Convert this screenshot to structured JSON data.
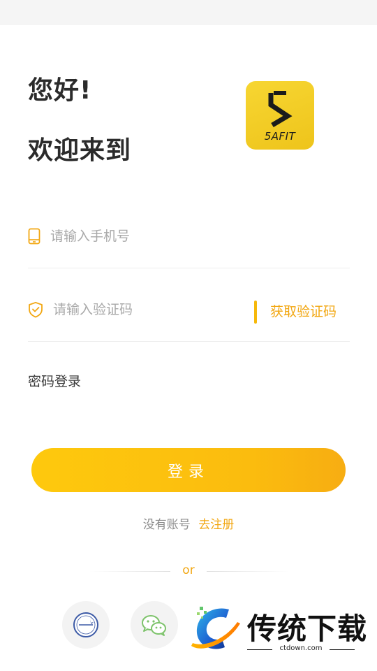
{
  "greeting": {
    "line1": "您好!",
    "line2": "欢迎来到"
  },
  "logo": {
    "text": "5AFIT",
    "bg_color": "#f2cb20"
  },
  "form": {
    "phone_placeholder": "请输入手机号",
    "code_placeholder": "请输入验证码",
    "get_code_label": "获取验证码",
    "password_login_label": "密码登录",
    "login_button": "登录"
  },
  "register": {
    "prompt": "没有账号",
    "link": "去注册"
  },
  "divider": {
    "text": "or"
  },
  "social": [
    {
      "name": "armor-login",
      "icon": "armor-logo-icon"
    },
    {
      "name": "wechat-login",
      "icon": "wechat-icon"
    }
  ],
  "watermark": {
    "title": "传统下载",
    "url": "ctdown.com"
  },
  "colors": {
    "accent": "#f2a712",
    "button": "#fbbf0e",
    "text_dark": "#2b2b2b",
    "placeholder": "#a9a9a9"
  }
}
